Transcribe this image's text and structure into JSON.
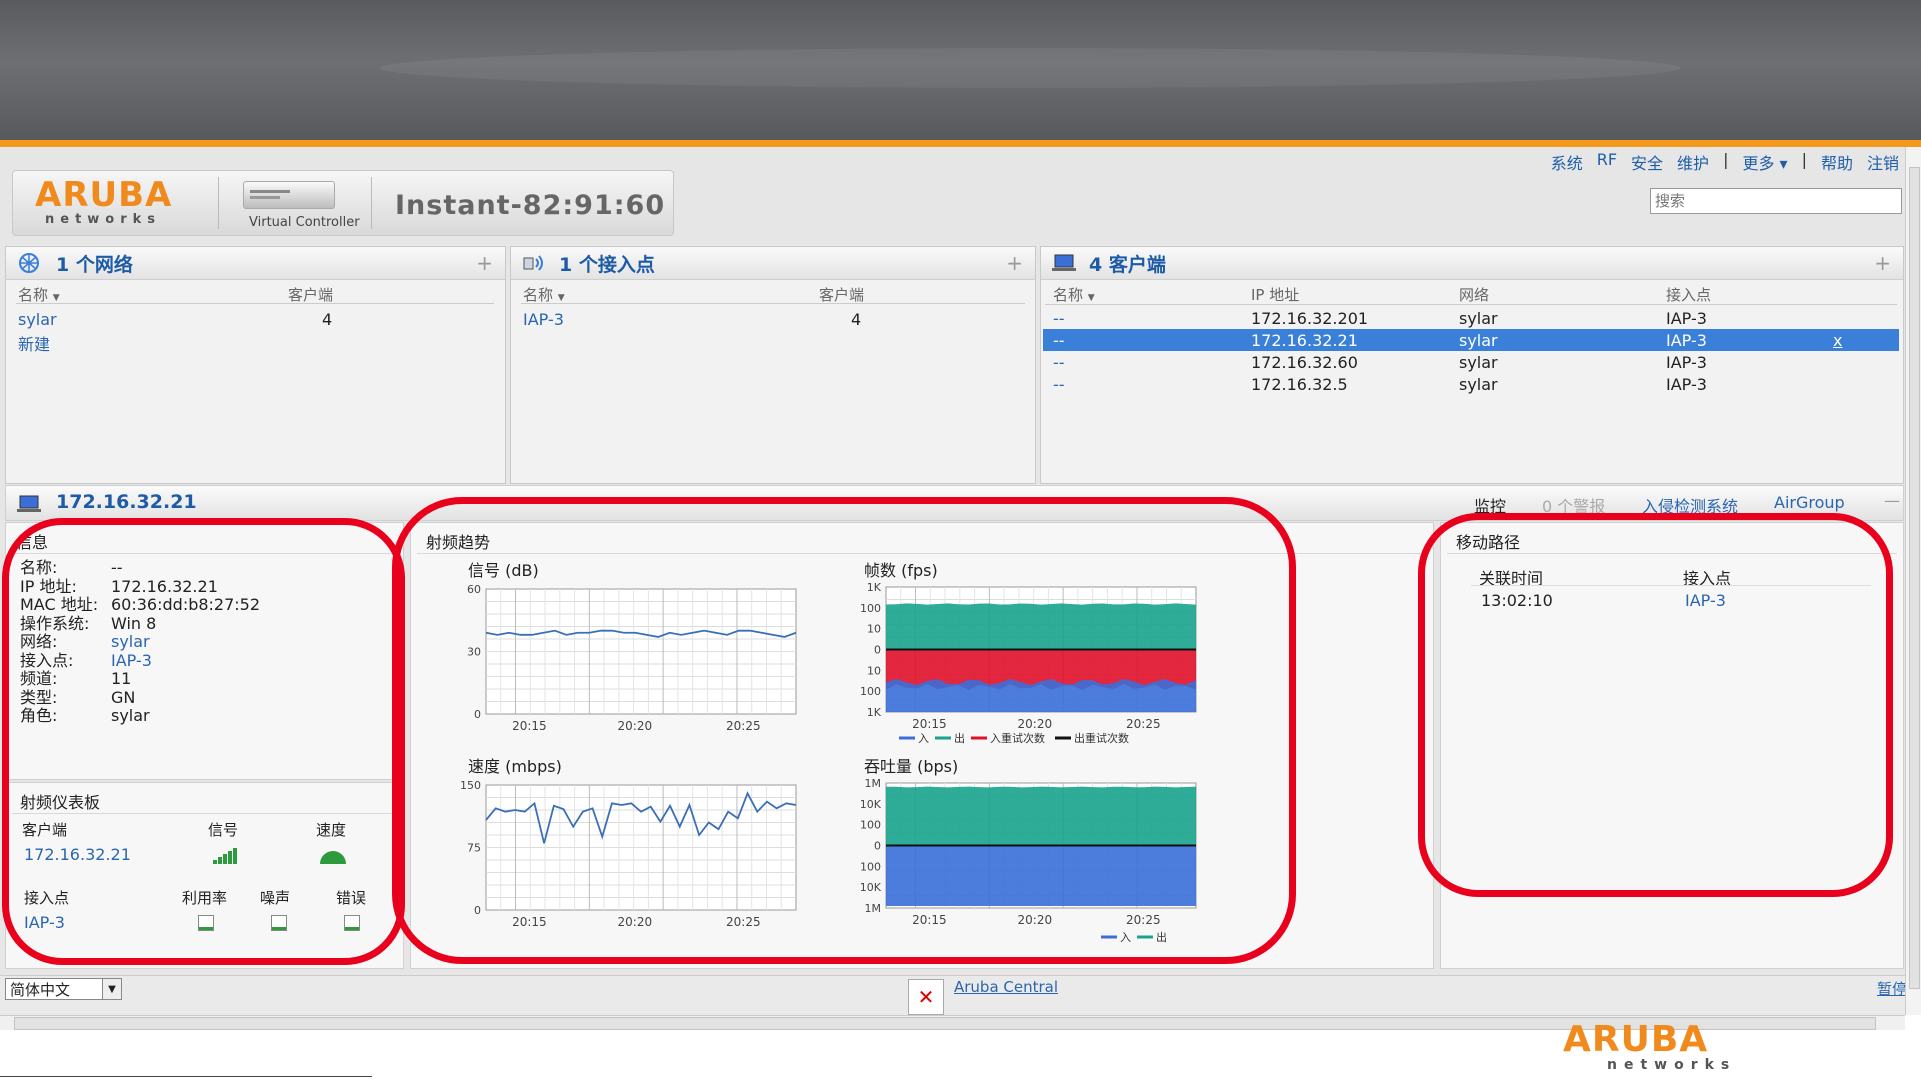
{
  "topnav": {
    "items": [
      "系统",
      "RF",
      "安全",
      "维护",
      "|",
      "更多 ▾",
      "|",
      "帮助",
      "注销"
    ]
  },
  "search": {
    "placeholder": "搜索"
  },
  "brand": {
    "word": "ARUBA",
    "sub": "networks",
    "vc_label": "Virtual Controller",
    "vc_name": "Instant-82:91:60"
  },
  "networks": {
    "title": "1 个网络",
    "col_name": "名称",
    "col_clients": "客户端",
    "rows": [
      {
        "name": "sylar",
        "clients": "4"
      }
    ],
    "new_link": "新建"
  },
  "aps": {
    "title": "1 个接入点",
    "col_name": "名称",
    "col_clients": "客户端",
    "rows": [
      {
        "name": "IAP-3",
        "clients": "4"
      }
    ]
  },
  "clients": {
    "title": "4 客户端",
    "col_name": "名称",
    "col_ip": "IP 地址",
    "col_network": "网络",
    "col_ap": "接入点",
    "rows": [
      {
        "name": "--",
        "ip": "172.16.32.201",
        "network": "sylar",
        "ap": "IAP-3"
      },
      {
        "name": "--",
        "ip": "172.16.32.21",
        "network": "sylar",
        "ap": "IAP-3",
        "close": "x"
      },
      {
        "name": "--",
        "ip": "172.16.32.60",
        "network": "sylar",
        "ap": "IAP-3"
      },
      {
        "name": "--",
        "ip": "172.16.32.5",
        "network": "sylar",
        "ap": "IAP-3"
      }
    ]
  },
  "detail": {
    "title": "172.16.32.21",
    "tabs": [
      "监控",
      "0 个警报",
      "入侵检测系统",
      "AirGroup"
    ],
    "collapse": "—"
  },
  "info": {
    "title": "信息",
    "rows": [
      {
        "k": "名称:",
        "v": "--"
      },
      {
        "k": "IP 地址:",
        "v": "172.16.32.21"
      },
      {
        "k": "MAC 地址:",
        "v": "60:36:dd:b8:27:52"
      },
      {
        "k": "操作系统:",
        "v": "Win 8"
      },
      {
        "k": "网络:",
        "v": "sylar"
      },
      {
        "k": "接入点:",
        "v": "IAP-3"
      },
      {
        "k": "频道:",
        "v": "11"
      },
      {
        "k": "类型:",
        "v": "GN"
      },
      {
        "k": "角色:",
        "v": "sylar"
      }
    ]
  },
  "rfdash": {
    "title": "射频仪表板",
    "client_head": "客户端",
    "signal_head": "信号",
    "speed_head": "速度",
    "client_value": "172.16.32.21",
    "ap_head": "接入点",
    "util_head": "利用率",
    "noise_head": "噪声",
    "error_head": "错误",
    "ap_value": "IAP-3"
  },
  "rftrend": {
    "title": "射频趋势",
    "signal_title": "信号 (dB)",
    "frames_title": "帧数 (fps)",
    "speed_title": "速度 (mbps)",
    "throughput_title": "吞吐量 (bps)",
    "xticks": [
      "20:15",
      "20:20",
      "20:25"
    ],
    "frames_legend": [
      "入",
      "出",
      "入重试次数",
      "出重试次数"
    ],
    "throughput_legend": [
      "入",
      "出"
    ],
    "colors": {
      "in": "#3a6fd8",
      "out": "#17a38c",
      "in_retry": "#e0102a",
      "out_retry": "#111111"
    }
  },
  "chart_data": [
    {
      "type": "line",
      "title": "信号 (dB)",
      "ylim": [
        0,
        60
      ],
      "yticks": [
        "0",
        "30",
        "60"
      ],
      "xticks": [
        "20:15",
        "20:20",
        "20:25"
      ],
      "values": [
        39,
        38,
        39,
        38,
        38,
        39,
        40,
        38,
        39,
        39,
        40,
        40,
        39,
        39,
        38,
        37,
        39,
        38,
        39,
        40,
        39,
        38,
        40,
        40,
        39,
        38,
        37,
        39
      ]
    },
    {
      "type": "area",
      "title": "帧数 (fps)",
      "yticks": [
        "1K",
        "100",
        "10",
        "0",
        "10",
        "100",
        "1K"
      ],
      "xticks": [
        "20:15",
        "20:20",
        "20:25"
      ],
      "series": [
        {
          "name": "入",
          "color": "#3a6fd8"
        },
        {
          "name": "出",
          "color": "#17a38c"
        },
        {
          "name": "入重试次数",
          "color": "#e0102a"
        },
        {
          "name": "出重试次数",
          "color": "#111111"
        }
      ]
    },
    {
      "type": "line",
      "title": "速度 (mbps)",
      "ylim": [
        0,
        150
      ],
      "yticks": [
        "0",
        "75",
        "150"
      ],
      "xticks": [
        "20:15",
        "20:20",
        "20:25"
      ],
      "values": [
        108,
        122,
        118,
        120,
        118,
        128,
        80,
        125,
        121,
        100,
        118,
        122,
        88,
        128,
        126,
        128,
        118,
        124,
        106,
        125,
        100,
        126,
        90,
        105,
        97,
        118,
        110,
        140,
        118,
        130,
        122,
        128,
        126
      ]
    },
    {
      "type": "area",
      "title": "吞吐量 (bps)",
      "yticks": [
        "1M",
        "10K",
        "100",
        "0",
        "100",
        "10K",
        "1M"
      ],
      "xticks": [
        "20:15",
        "20:20",
        "20:25"
      ],
      "series": [
        {
          "name": "入",
          "color": "#3a6fd8"
        },
        {
          "name": "出",
          "color": "#17a38c"
        }
      ]
    }
  ],
  "mobility": {
    "title": "移动路径",
    "col_time": "关联时间",
    "col_ap": "接入点",
    "rows": [
      {
        "time": "13:02:10",
        "ap": "IAP-3"
      }
    ]
  },
  "footer": {
    "lang": "简体中文",
    "central": "Aruba Central",
    "pause": "暂停"
  }
}
